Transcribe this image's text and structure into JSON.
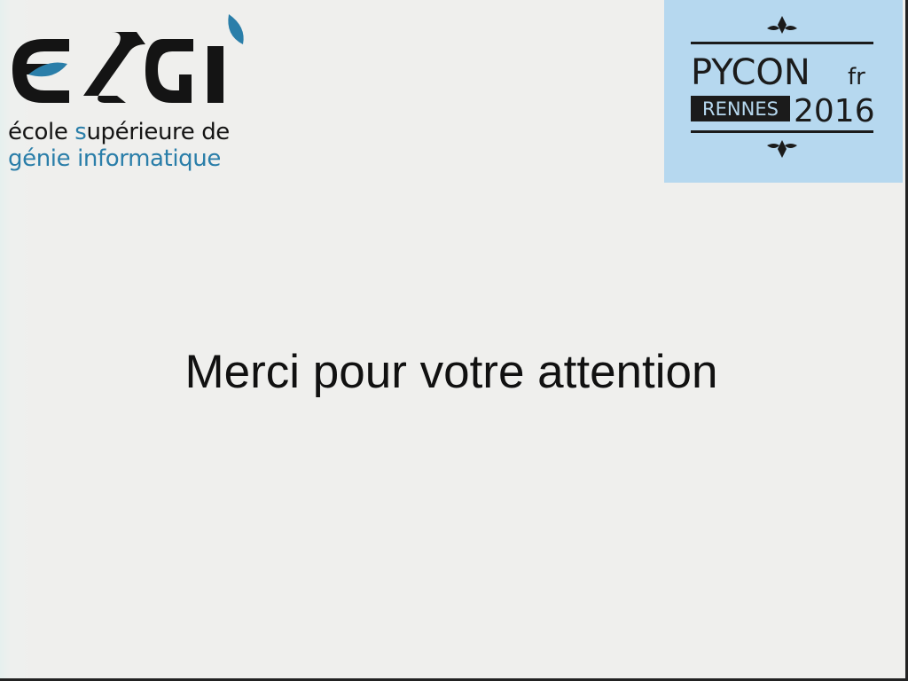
{
  "esgi_logo": {
    "wordmark": "ESGI",
    "tagline_line1": {
      "part1_initial": "é",
      "part1_rest": "cole ",
      "part2_initial": "s",
      "part2_rest": "upérieure de"
    },
    "tagline_line2": {
      "part1_initial": "g",
      "part1_rest": "énie ",
      "part2_initial": "i",
      "part2_rest": "nformatique"
    }
  },
  "pycon_logo": {
    "title": "PYCON",
    "suffix": "fr",
    "city": "RENNES",
    "year": "2016"
  },
  "slide": {
    "message": "Merci pour votre attention"
  },
  "colors": {
    "background": "#efefed",
    "esgi_blue": "#2a7ea9",
    "esgi_dark": "#141414",
    "pycon_panel": "#b6d8ef",
    "pycon_ink": "#1b1b1b"
  }
}
